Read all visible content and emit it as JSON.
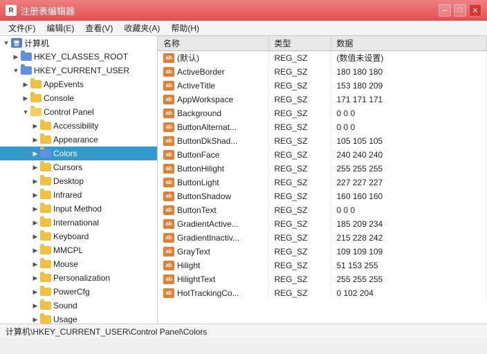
{
  "window": {
    "title": "注册表编辑器",
    "icon": "reg"
  },
  "titlebar_controls": {
    "minimize": "－",
    "maximize": "□",
    "close": "✕"
  },
  "menu": {
    "items": [
      {
        "label": "文件(F)"
      },
      {
        "label": "编辑(E)"
      },
      {
        "label": "查看(V)"
      },
      {
        "label": "收藏夹(A)"
      },
      {
        "label": "帮助(H)"
      }
    ]
  },
  "tree": {
    "items": [
      {
        "id": "computer",
        "label": "计算机",
        "level": 0,
        "expanded": true,
        "type": "computer"
      },
      {
        "id": "hkey_classes_root",
        "label": "HKEY_CLASSES_ROOT",
        "level": 1,
        "expanded": false,
        "type": "folder"
      },
      {
        "id": "hkey_current_user",
        "label": "HKEY_CURRENT_USER",
        "level": 1,
        "expanded": true,
        "type": "folder"
      },
      {
        "id": "appevents",
        "label": "AppEvents",
        "level": 2,
        "expanded": false,
        "type": "folder"
      },
      {
        "id": "console",
        "label": "Console",
        "level": 2,
        "expanded": false,
        "type": "folder"
      },
      {
        "id": "control_panel",
        "label": "Control Panel",
        "level": 2,
        "expanded": true,
        "type": "folder"
      },
      {
        "id": "accessibility",
        "label": "Accessibility",
        "level": 3,
        "expanded": false,
        "type": "folder"
      },
      {
        "id": "appearance",
        "label": "Appearance",
        "level": 3,
        "expanded": false,
        "type": "folder"
      },
      {
        "id": "colors",
        "label": "Colors",
        "level": 3,
        "expanded": false,
        "type": "folder",
        "selected": true
      },
      {
        "id": "cursors",
        "label": "Cursors",
        "level": 3,
        "expanded": false,
        "type": "folder"
      },
      {
        "id": "desktop",
        "label": "Desktop",
        "level": 3,
        "expanded": false,
        "type": "folder"
      },
      {
        "id": "infrared",
        "label": "Infrared",
        "level": 3,
        "expanded": false,
        "type": "folder"
      },
      {
        "id": "input_method",
        "label": "Input Method",
        "level": 3,
        "expanded": false,
        "type": "folder"
      },
      {
        "id": "international",
        "label": "International",
        "level": 3,
        "expanded": false,
        "type": "folder"
      },
      {
        "id": "keyboard",
        "label": "Keyboard",
        "level": 3,
        "expanded": false,
        "type": "folder"
      },
      {
        "id": "mmcpl",
        "label": "MMCPL",
        "level": 3,
        "expanded": false,
        "type": "folder"
      },
      {
        "id": "mouse",
        "label": "Mouse",
        "level": 3,
        "expanded": false,
        "type": "folder"
      },
      {
        "id": "personalization",
        "label": "Personalization",
        "level": 3,
        "expanded": false,
        "type": "folder"
      },
      {
        "id": "powercfg",
        "label": "PowerCfg",
        "level": 3,
        "expanded": false,
        "type": "folder"
      },
      {
        "id": "sound",
        "label": "Sound",
        "level": 3,
        "expanded": false,
        "type": "folder"
      },
      {
        "id": "usage",
        "label": "Usage",
        "level": 3,
        "expanded": false,
        "type": "folder"
      }
    ]
  },
  "registry_values": {
    "columns": [
      "名称",
      "类型",
      "数据"
    ],
    "rows": [
      {
        "name": "(默认)",
        "type": "REG_SZ",
        "data": "(数值未设置)",
        "default": true
      },
      {
        "name": "ActiveBorder",
        "type": "REG_SZ",
        "data": "180 180 180"
      },
      {
        "name": "ActiveTitle",
        "type": "REG_SZ",
        "data": "153 180 209"
      },
      {
        "name": "AppWorkspace",
        "type": "REG_SZ",
        "data": "171 171 171"
      },
      {
        "name": "Background",
        "type": "REG_SZ",
        "data": "0 0 0"
      },
      {
        "name": "ButtonAlternat...",
        "type": "REG_SZ",
        "data": "0 0 0"
      },
      {
        "name": "ButtonDkShad...",
        "type": "REG_SZ",
        "data": "105 105 105"
      },
      {
        "name": "ButtonFace",
        "type": "REG_SZ",
        "data": "240 240 240"
      },
      {
        "name": "ButtonHilight",
        "type": "REG_SZ",
        "data": "255 255 255"
      },
      {
        "name": "ButtonLight",
        "type": "REG_SZ",
        "data": "227 227 227"
      },
      {
        "name": "ButtonShadow",
        "type": "REG_SZ",
        "data": "160 160 160"
      },
      {
        "name": "ButtonText",
        "type": "REG_SZ",
        "data": "0 0 0"
      },
      {
        "name": "GradientActive...",
        "type": "REG_SZ",
        "data": "185 209 234"
      },
      {
        "name": "GradientInactiv...",
        "type": "REG_SZ",
        "data": "215 228 242"
      },
      {
        "name": "GrayText",
        "type": "REG_SZ",
        "data": "109 109 109"
      },
      {
        "name": "Hilight",
        "type": "REG_SZ",
        "data": "51 153 255"
      },
      {
        "name": "HilightText",
        "type": "REG_SZ",
        "data": "255 255 255"
      },
      {
        "name": "HotTrackingCo...",
        "type": "REG_SZ",
        "data": "0 102 204"
      }
    ]
  },
  "status_bar": {
    "path": "计算机\\HKEY_CURRENT_USER\\Control Panel\\Colors"
  }
}
